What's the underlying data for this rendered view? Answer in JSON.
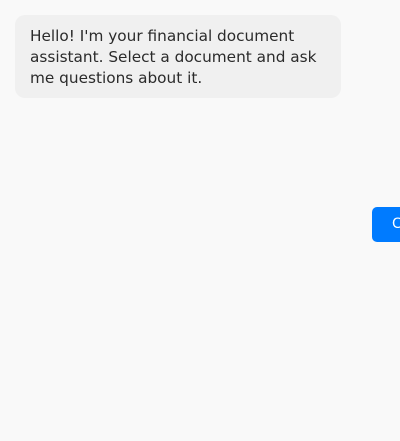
{
  "chat": {
    "messages": [
      {
        "role": "assistant",
        "text": "Hello! I'm your financial document assistant. Select a document and ask me questions about it."
      }
    ]
  },
  "actions": {
    "button_label": "C"
  },
  "colors": {
    "page_background": "#f9f9f9",
    "bubble_background": "#f0f0f0",
    "accent": "#007bff"
  }
}
